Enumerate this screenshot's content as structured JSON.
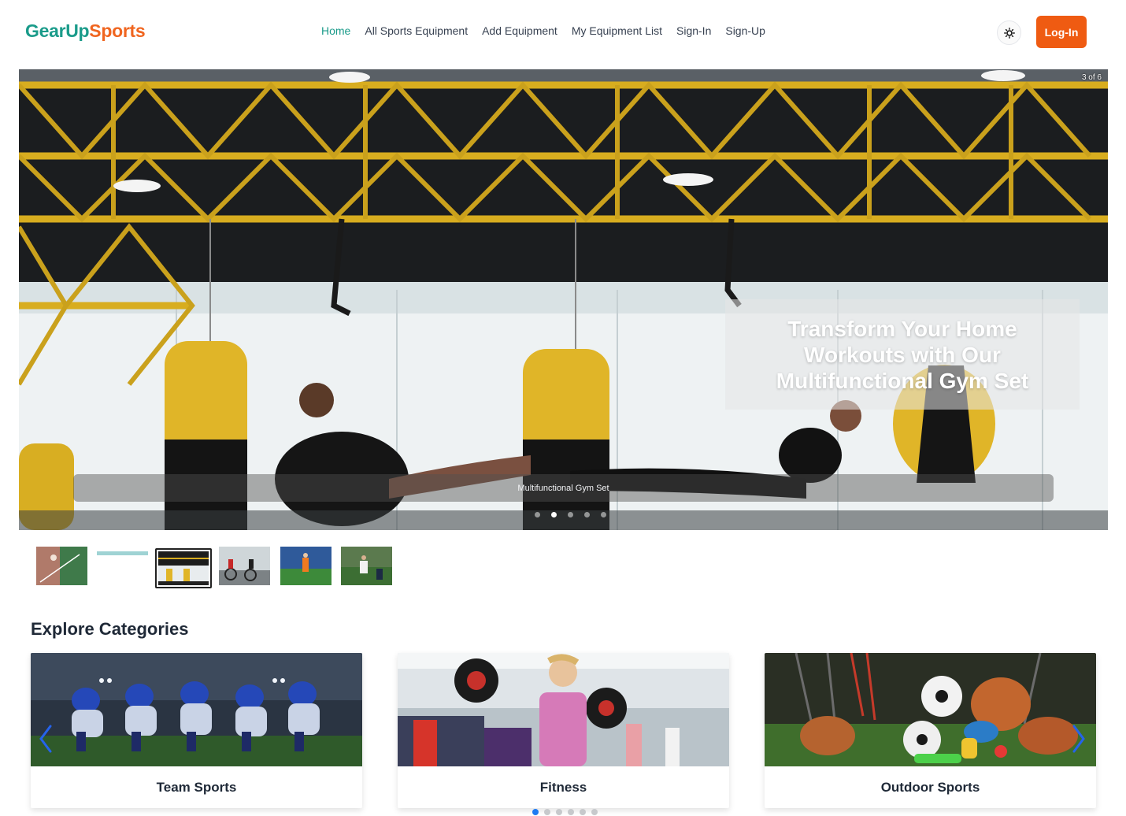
{
  "brand": {
    "part1": "GearUp",
    "part2": "Sports",
    "color1": "#1a9b8a",
    "color2": "#f0651f"
  },
  "nav": {
    "items": [
      {
        "label": "Home",
        "active": true
      },
      {
        "label": "All Sports Equipment",
        "active": false
      },
      {
        "label": "Add Equipment",
        "active": false
      },
      {
        "label": "My Equipment List",
        "active": false
      },
      {
        "label": "Sign-In",
        "active": false
      },
      {
        "label": "Sign-Up",
        "active": false
      }
    ],
    "theme_icon": "sun-icon",
    "login_label": "Log-In",
    "login_color": "#ef5b12"
  },
  "hero": {
    "counter": "3 of 6",
    "headline": "Transform Your Home Workouts with Our Multifunctional Gym Set",
    "caption": "Multifunctional Gym Set",
    "slide_count": 5,
    "active_slide": 2
  },
  "thumbnails": {
    "count": 6,
    "selected": 2
  },
  "categories": {
    "title": "Explore Categories",
    "items": [
      {
        "label": "Team Sports"
      },
      {
        "label": "Fitness"
      },
      {
        "label": "Outdoor Sports"
      }
    ],
    "prev_icon": "chevron-left-icon",
    "next_icon": "chevron-right-icon",
    "page_count": 6,
    "active_page": 0,
    "dot_active_color": "#1e7bf2"
  }
}
